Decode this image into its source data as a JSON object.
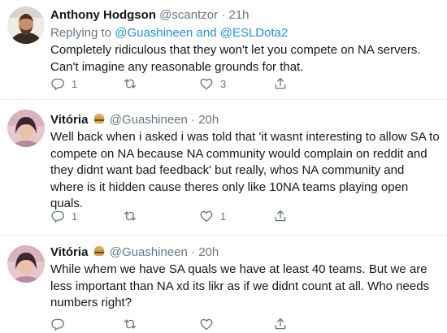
{
  "tweets": [
    {
      "name": "Anthony Hodgson",
      "handle": "@scantzor",
      "separator": "·",
      "time": "21h",
      "reply_prefix": "Replying to",
      "reply_to_1": "@Guashineen",
      "reply_and": "and",
      "reply_to_2": "@ESLDota2",
      "text": "Completely ridiculous that they won't let you compete on NA servers. Can't imagine any reasonable grounds for that.",
      "replies": "1",
      "retweets": "",
      "likes": "3"
    },
    {
      "name": "Vitória",
      "emoji": "burger",
      "handle": "@Guashineen",
      "separator": "·",
      "time": "20h",
      "text": "Well back when i asked i was told that 'it wasnt interesting to allow SA to compete on NA because NA community would complain on reddit and they didnt want bad feedback' but really, whos NA community and where is it hidden cause theres only like 10NA teams playing open quals.",
      "replies": "1",
      "retweets": "",
      "likes": "1"
    },
    {
      "name": "Vitória",
      "emoji": "burger",
      "handle": "@Guashineen",
      "separator": "·",
      "time": "20h",
      "text": "While whem we have SA quals we have at least 40 teams. But we are less important than NA xd its likr as if we didnt count at all. Who needs numbers right?",
      "replies": "",
      "retweets": "",
      "likes": ""
    }
  ],
  "icons": {
    "reply": "reply-icon",
    "retweet": "retweet-icon",
    "like": "heart-icon",
    "share": "share-icon"
  },
  "colors": {
    "link": "#1b95e0",
    "secondary": "#657786",
    "text": "#14171a",
    "divider": "#e6ecf0"
  }
}
